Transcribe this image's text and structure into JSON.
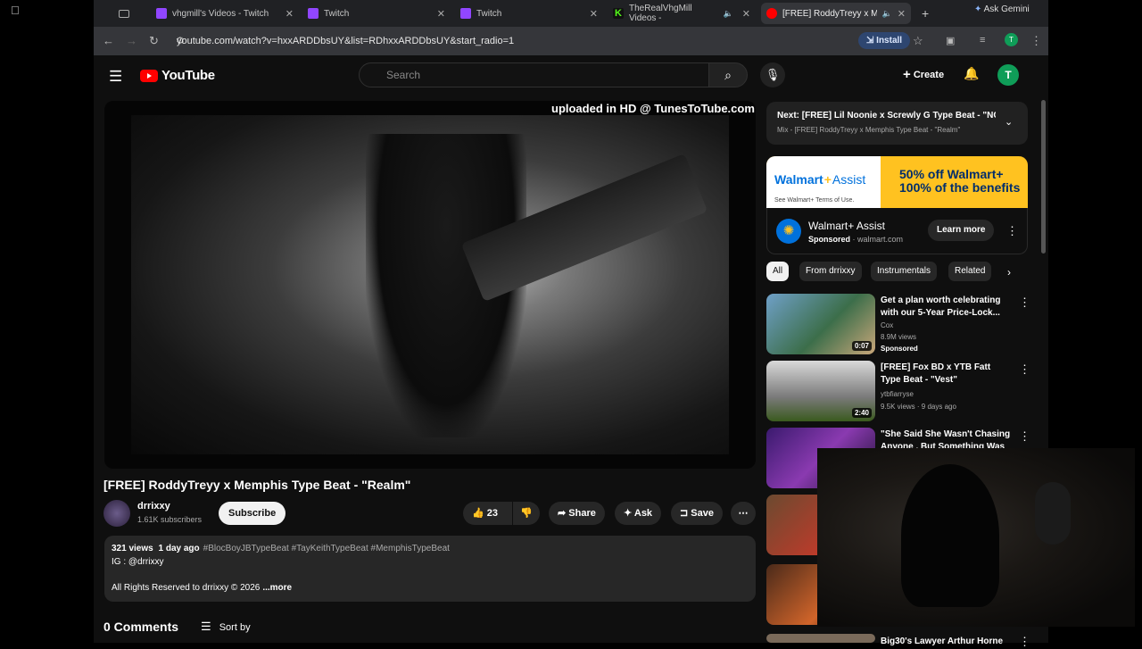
{
  "browser": {
    "tabs": [
      {
        "label": "vhgmill's Videos - Twitch",
        "icon": "twitch-icon"
      },
      {
        "label": "Twitch",
        "icon": "twitch-icon"
      },
      {
        "label": "Twitch",
        "icon": "twitch-icon"
      },
      {
        "label": "TheRealVhgMill Videos -",
        "icon": "kick-icon"
      },
      {
        "label": "[FREE] RoddyTreyy x Mem",
        "icon": "youtube-icon",
        "active": true
      }
    ],
    "url": "youtube.com/watch?v=hxxARDDbsUY&list=RDhxxARDDbsUY&start_radio=1",
    "install_label": "Install",
    "ask_gemini": "Ask Gemini"
  },
  "header": {
    "logo_text": "YouTube",
    "search_placeholder": "Search",
    "create_label": "Create",
    "avatar_letter": "T"
  },
  "video": {
    "watermark": "uploaded in HD @ TunesToTube.com",
    "title": "[FREE] RoddyTreyy x Memphis Type Beat - \"Realm\"",
    "channel": "drrixxy",
    "subscribers": "1.61K subscribers",
    "subscribe_label": "Subscribe",
    "likes": "23",
    "share_label": "Share",
    "ask_label": "Ask",
    "save_label": "Save",
    "views": "321 views",
    "age": "1 day ago",
    "tags": "#BlocBoyJBTypeBeat #TayKeithTypeBeat #MemphisTypeBeat",
    "desc_line2": "IG : @drrixxy",
    "desc_line3": "All Rights Reserved to drrixxy © 2026",
    "more_label": "...more",
    "comments": "0 Comments",
    "sort_label": "Sort by"
  },
  "sidebar": {
    "next_title": "Next: [FREE] Lil Noonie x Screwly G Type Beat - \"NO...",
    "next_sub": "Mix - [FREE] RoddyTreyy x Memphis Type Beat - \"Realm\"",
    "ad": {
      "brand": "Walmart",
      "brand_suffix": "Assist",
      "terms": "See Walmart+ Terms of Use.",
      "offer1": "50% off Walmart+",
      "offer2": "100% of the benefits",
      "name": "Walmart+ Assist",
      "sponsored": "Sponsored",
      "domain": "· walmart.com",
      "cta": "Learn more"
    },
    "chips": [
      "All",
      "From drrixxy",
      "Instrumentals",
      "Related"
    ],
    "videos": [
      {
        "title": "Get a plan worth celebrating with our 5-Year Price-Lock...",
        "channel": "Cox",
        "meta": "8.9M views",
        "badge": "Sponsored",
        "duration": "0:07"
      },
      {
        "title": "[FREE] Fox BD x YTB Fatt Type Beat - \"Vest\"",
        "channel": "ytbfiarryse",
        "meta": "9.5K views · 9 days ago",
        "duration": "2:40"
      },
      {
        "title": "\"She Said She Wasn't Chasing Anyone , But Something Was",
        "channel": "",
        "meta": ""
      },
      {
        "title": "Big30's Lawyer Arthur Horne",
        "channel": "",
        "meta": ""
      }
    ]
  }
}
